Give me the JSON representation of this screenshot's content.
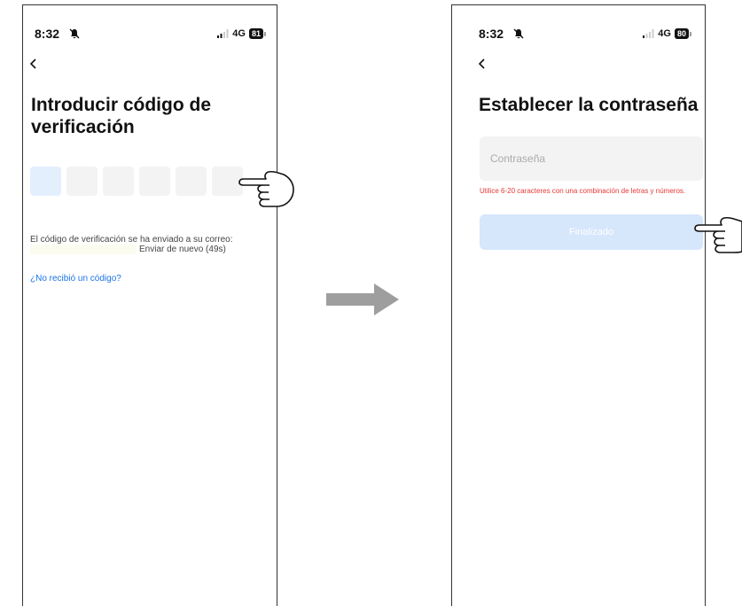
{
  "screen1": {
    "status": {
      "time": "8:32",
      "network": "4G",
      "battery": "81"
    },
    "title": "Introducir código de verificación",
    "code_box_count": 6,
    "info_text": "El código de verificación se ha enviado a su correo:",
    "resend_label": "Enviar de nuevo (49s)",
    "no_code_link": "¿No recibió un código?"
  },
  "screen2": {
    "status": {
      "time": "8:32",
      "network": "4G",
      "battery": "80"
    },
    "title": "Establecer la contraseña",
    "password_placeholder": "Contraseña",
    "password_hint": "Utilice 6-20 caracteres con una combinación de letras y números.",
    "finish_label": "Finalizado"
  },
  "colors": {
    "link": "#1a73e8",
    "error": "#e53935",
    "button_disabled": "#d6e6fb",
    "active_box": "#e4effd"
  }
}
